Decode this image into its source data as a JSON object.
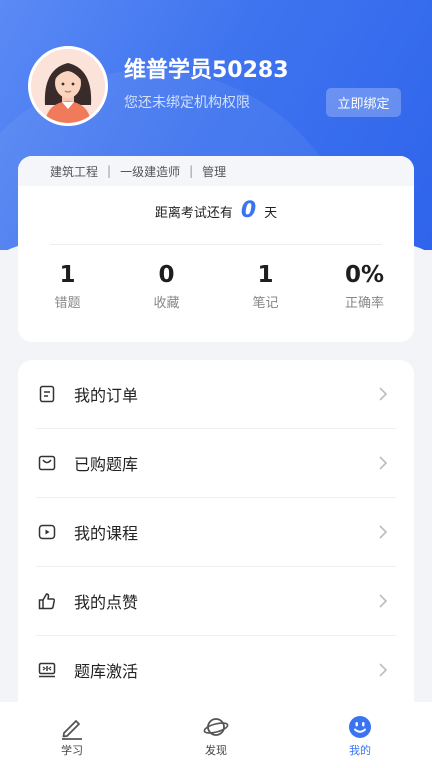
{
  "profile": {
    "name": "维普学员50283",
    "subtitle": "您还未绑定机构权限",
    "bind_button": "立即绑定"
  },
  "course_path": [
    "建筑工程",
    "一级建造师",
    "管理"
  ],
  "countdown": {
    "prefix": "距离考试还有",
    "days": "0",
    "suffix": "天"
  },
  "stats": [
    {
      "value": "1",
      "label": "错题"
    },
    {
      "value": "0",
      "label": "收藏"
    },
    {
      "value": "1",
      "label": "笔记"
    },
    {
      "value": "0%",
      "label": "正确率"
    }
  ],
  "menu": [
    {
      "label": "我的订单",
      "icon": "order-icon"
    },
    {
      "label": "已购题库",
      "icon": "bag-icon"
    },
    {
      "label": "我的课程",
      "icon": "video-icon"
    },
    {
      "label": "我的点赞",
      "icon": "thumbs-up-icon"
    },
    {
      "label": "题库激活",
      "icon": "activate-icon"
    }
  ],
  "tabs": [
    {
      "label": "学习",
      "icon": "pencil-icon"
    },
    {
      "label": "发现",
      "icon": "planet-icon"
    },
    {
      "label": "我的",
      "icon": "smiley-icon",
      "active": true
    }
  ],
  "colors": {
    "accent": "#3a74f0",
    "header_gradient_start": "#5b8af5",
    "header_gradient_end": "#2f64ec"
  }
}
